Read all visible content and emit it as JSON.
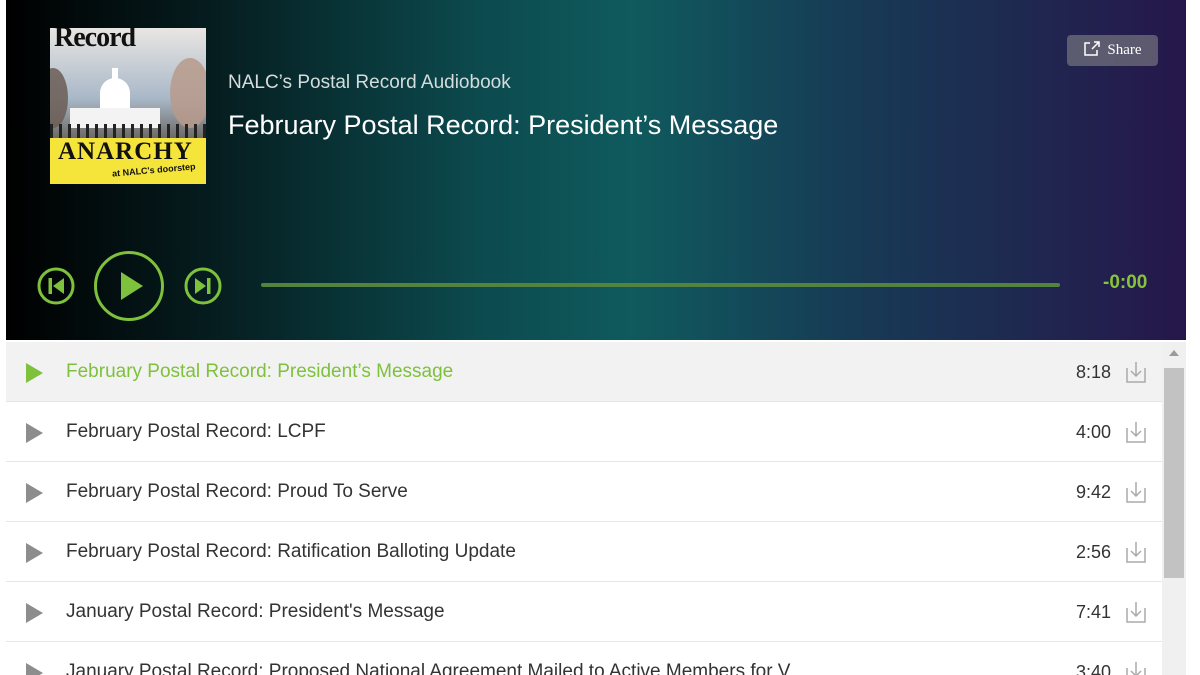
{
  "player": {
    "cover_art": {
      "masthead": "Record",
      "headline": "ANARCHY",
      "subheadline": "at NALC's doorstep"
    },
    "show_title": "NALC’s Postal Record Audiobook",
    "episode_title": "February Postal Record: President’s Message",
    "share_label": "Share",
    "time_remaining": "-0:00",
    "progress_fraction": 0.0,
    "icons": {
      "share": "share-icon",
      "previous": "skip-previous-icon",
      "play": "play-icon",
      "next": "skip-next-icon",
      "download": "download-icon"
    },
    "colors": {
      "accent": "#7ec13c",
      "progress_track": "#548340"
    }
  },
  "tracks": [
    {
      "title": "February Postal Record: President’s Message",
      "duration": "8:18",
      "active": true
    },
    {
      "title": "February Postal Record: LCPF",
      "duration": "4:00",
      "active": false
    },
    {
      "title": "February Postal Record: Proud To Serve",
      "duration": "9:42",
      "active": false
    },
    {
      "title": "February Postal Record: Ratification Balloting Update",
      "duration": "2:56",
      "active": false
    },
    {
      "title": "January Postal Record: President's Message",
      "duration": "7:41",
      "active": false
    },
    {
      "title": "January Postal Record: Proposed National Agreement Mailed to Active Members for V",
      "duration": "3:40",
      "active": false
    }
  ]
}
